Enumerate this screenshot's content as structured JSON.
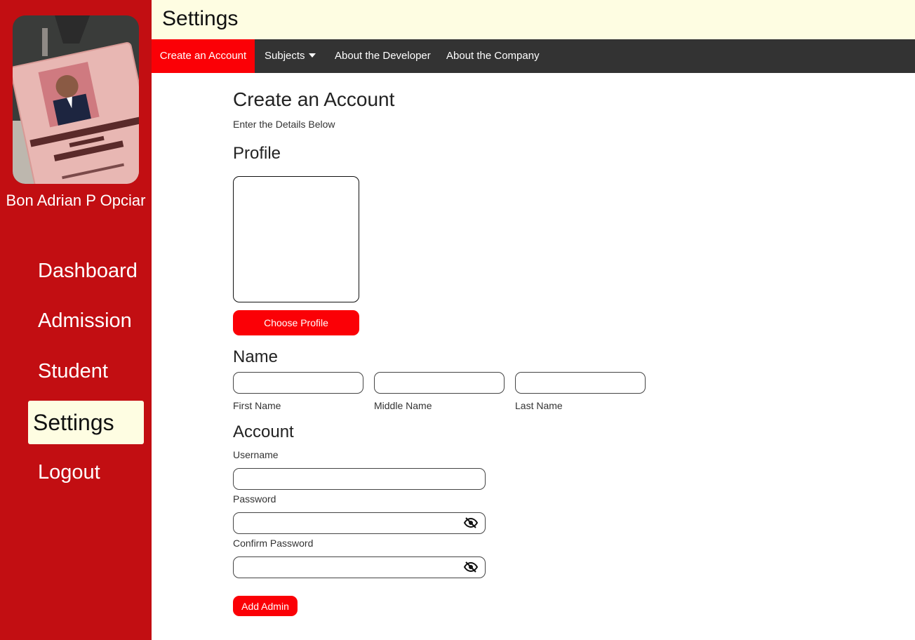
{
  "header": {
    "title": "Settings"
  },
  "user": {
    "name": "Bon Adrian P Opciar"
  },
  "sidebar": {
    "items": [
      {
        "label": "Dashboard"
      },
      {
        "label": "Admission"
      },
      {
        "label": "Student"
      },
      {
        "label": "Settings",
        "active": true
      },
      {
        "label": "Logout"
      }
    ]
  },
  "topnav": {
    "tabs": [
      {
        "label": "Create an Account",
        "active": true
      },
      {
        "label": "Subjects",
        "icon": "caret-down-icon"
      },
      {
        "label": "About the Developer"
      },
      {
        "label": "About the Company"
      }
    ]
  },
  "form": {
    "title": "Create an Account",
    "subtitle": "Enter the Details Below",
    "profile_section": "Profile",
    "choose_profile_label": "Choose Profile",
    "name_section": "Name",
    "first_name_label": "First Name",
    "middle_name_label": "Middle Name",
    "last_name_label": "Last Name",
    "account_section": "Account",
    "username_label": "Username",
    "password_label": "Password",
    "confirm_password_label": "Confirm Password",
    "submit_label": "Add Admin",
    "values": {
      "first_name": "",
      "middle_name": "",
      "last_name": "",
      "username": "",
      "password": "",
      "confirm_password": ""
    }
  },
  "colors": {
    "sidebar": "#c20e12",
    "accent": "#fb0006",
    "header_bg": "#fefde2",
    "topnav_bg": "#333333"
  }
}
